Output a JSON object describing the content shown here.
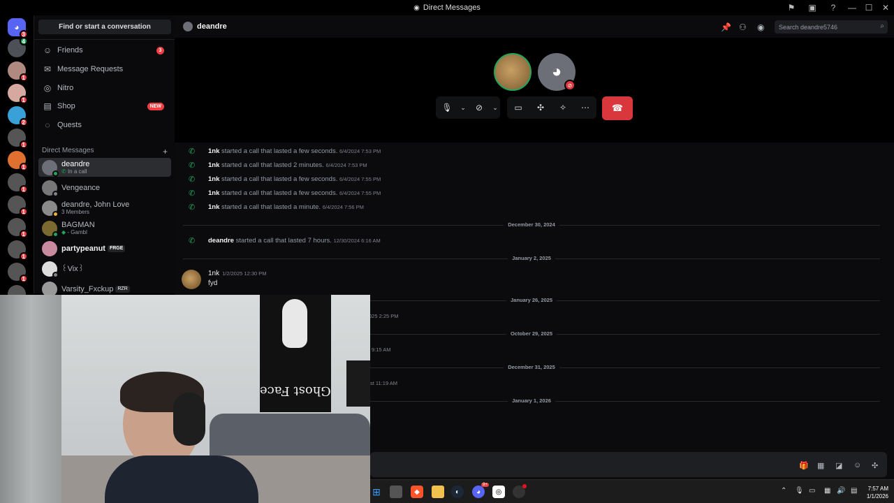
{
  "window": {
    "title": "Direct Messages"
  },
  "sidebar": {
    "find_label": "Find or start a conversation",
    "nav": [
      {
        "label": "Friends",
        "icon": "friends-icon",
        "badge": "3"
      },
      {
        "label": "Message Requests",
        "icon": "mail-icon"
      },
      {
        "label": "Nitro",
        "icon": "nitro-icon"
      },
      {
        "label": "Shop",
        "icon": "shop-icon",
        "badge": "NEW"
      },
      {
        "label": "Quests",
        "icon": "quests-icon"
      }
    ],
    "dm_header": "Direct Messages",
    "dms": [
      {
        "name": "deandre",
        "sub": "In a call",
        "status": "#23a55a"
      },
      {
        "name": "Vengeance",
        "sub": ""
      },
      {
        "name": "deandre, John Love",
        "sub": "3 Members"
      },
      {
        "name": "BAGMAN",
        "sub": "- Gambl"
      },
      {
        "name": "partypeanut",
        "tag": "FRGE"
      },
      {
        "name": "꒰Vix꒱",
        "sub": ""
      },
      {
        "name": "Varsity_Fxckup",
        "tag": "RZR"
      }
    ]
  },
  "rail": {
    "badges": [
      "3",
      "4",
      "1",
      "1",
      "2",
      "1",
      "1",
      "1",
      "1",
      "1",
      "1",
      "1",
      "1"
    ]
  },
  "channel": {
    "name": "deandre",
    "search_placeholder": "Search deandre5746"
  },
  "messages": {
    "calls": [
      {
        "who": "1nk",
        "text": " started a call that lasted a few seconds.",
        "ts": "6/4/2024 7:53 PM"
      },
      {
        "who": "1nk",
        "text": " started a call that lasted 2 minutes.",
        "ts": "6/4/2024 7:53 PM"
      },
      {
        "who": "1nk",
        "text": " started a call that lasted a few seconds.",
        "ts": "6/4/2024 7:55 PM"
      },
      {
        "who": "1nk",
        "text": " started a call that lasted a few seconds.",
        "ts": "6/4/2024 7:55 PM"
      },
      {
        "who": "1nk",
        "text": " started a call that lasted a minute.",
        "ts": "6/4/2024 7:56 PM"
      }
    ],
    "dividers": [
      "December 30, 2024",
      "January 2, 2025",
      "January 26, 2025",
      "October 29, 2025",
      "December 31, 2025",
      "January 1, 2026"
    ],
    "call2": {
      "who": "deandre",
      "text": " started a call that lasted 7 hours.",
      "ts": "12/30/2024 6:16 AM"
    },
    "msg": {
      "author": "1nk",
      "ts": "1/2/2025 12:30 PM",
      "text": "fyd"
    },
    "partial": [
      "025 2:25 PM",
      "9:15 AM",
      "st 11:19 AM"
    ]
  },
  "taskbar": {
    "time": "7:57 AM",
    "date": "1/1/2026",
    "discord_badge": "9+"
  },
  "colors": {
    "accent": "#5865f2",
    "hangup": "#da373c",
    "online": "#23a55a",
    "badge": "#f23f43"
  }
}
